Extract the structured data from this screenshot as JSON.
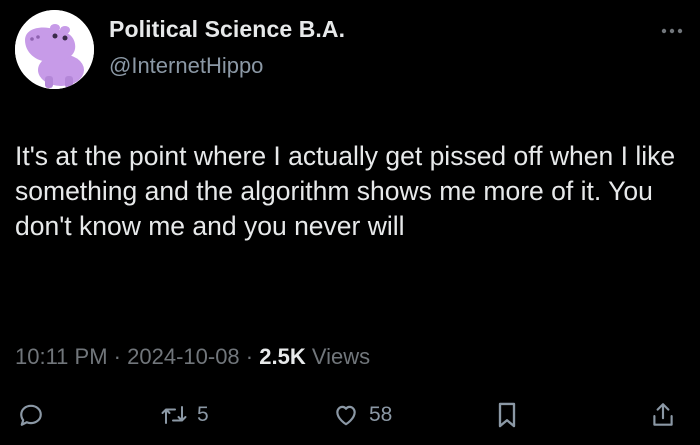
{
  "author": {
    "display_name": "Political Science B.A.",
    "handle": "@InternetHippo",
    "avatar_icon": "purple-hippo-avatar"
  },
  "tweet": {
    "text": "It's at the point where I actually get pissed off when I like something and the algorithm shows me more of it. You don't know me and you never will"
  },
  "meta": {
    "time": "10:11 PM",
    "separator": "·",
    "date": "2024-10-08",
    "views_count": "2.5K",
    "views_label": "Views"
  },
  "actions": {
    "reply_icon": "reply-icon",
    "repost_icon": "repost-icon",
    "repost_count": "5",
    "like_icon": "heart-icon",
    "like_count": "58",
    "bookmark_icon": "bookmark-icon",
    "share_icon": "share-icon"
  },
  "colors": {
    "background": "#000000",
    "primary_text": "#e7e9ea",
    "secondary_text": "#8b98a5",
    "avatar_hippo": "#c79be8"
  }
}
